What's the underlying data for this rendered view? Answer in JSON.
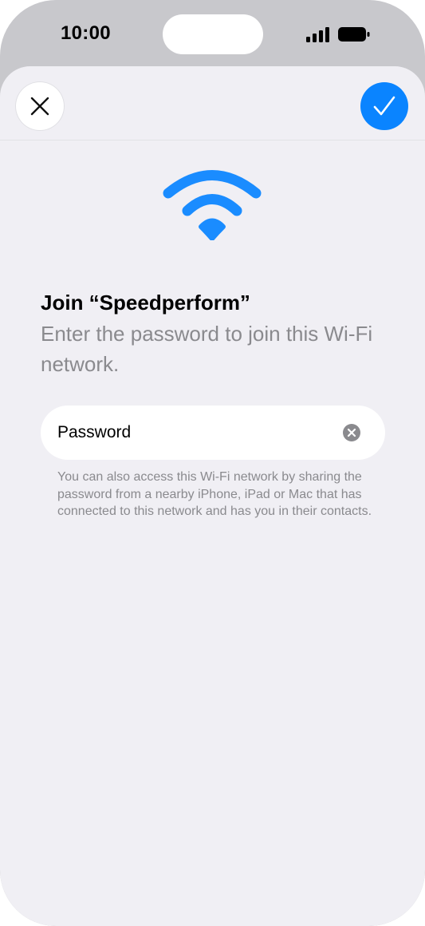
{
  "status_bar": {
    "time": "10:00",
    "icons": [
      "signal-icon",
      "battery-icon"
    ]
  },
  "header": {
    "close_icon": "close-icon",
    "confirm_icon": "checkmark-icon"
  },
  "wifi": {
    "icon": "wifi-icon"
  },
  "content": {
    "title": "Join “Speedperform”",
    "subtitle": "Enter the password to join this Wi-Fi network.",
    "password_placeholder": "Password",
    "password_value": "",
    "clear_icon": "clear-icon",
    "footnote": "You can also access this Wi-Fi network by sharing the password from a nearby iPhone, iPad or Mac that has connected to this network and has you in their contacts."
  },
  "colors": {
    "accent": "#0a84ff",
    "sheet_background": "#f0eff4",
    "secondary_text": "#8a8a8e"
  }
}
